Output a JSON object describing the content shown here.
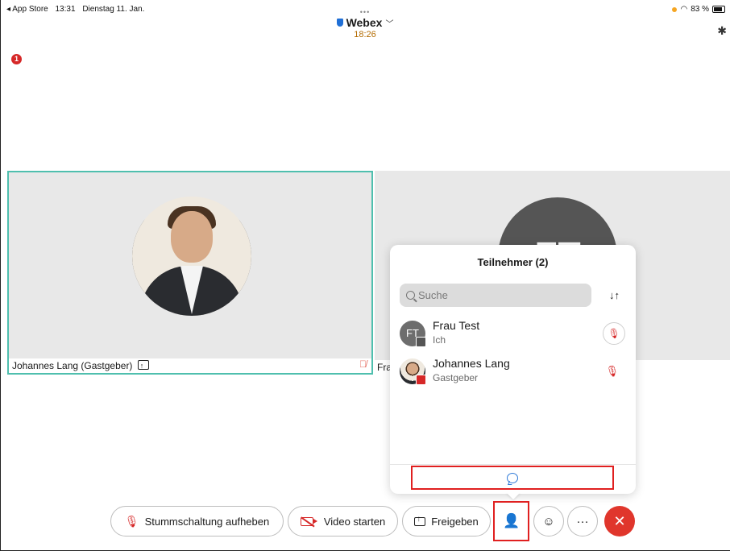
{
  "status_bar": {
    "back_app": "◂ App Store",
    "time": "13:31",
    "date": "Dienstag 11. Jan.",
    "battery": "83 %"
  },
  "header": {
    "app_title": "Webex",
    "meeting_time": "18:26",
    "grabber": "•••"
  },
  "alert_count": "1",
  "tiles": {
    "left_label": "Johannes Lang (Gastgeber)",
    "right_initials": "FT",
    "right_label_partial": "Fra"
  },
  "participants_panel": {
    "title": "Teilnehmer (2)",
    "search_placeholder": "Suche",
    "participants": [
      {
        "initials": "FT",
        "name": "Frau Test",
        "subtitle": "Ich"
      },
      {
        "initials": "",
        "name": "Johannes Lang",
        "subtitle": "Gastgeber"
      }
    ]
  },
  "toolbar": {
    "unmute_label": "Stummschaltung aufheben",
    "video_label": "Video starten",
    "share_label": "Freigeben",
    "more_label": "···",
    "end_label": "✕"
  },
  "colors": {
    "accent_blue": "#2f7ad8",
    "end_red": "#e0362c",
    "active_border": "#4fbfae",
    "highlight_red": "#e02020"
  }
}
